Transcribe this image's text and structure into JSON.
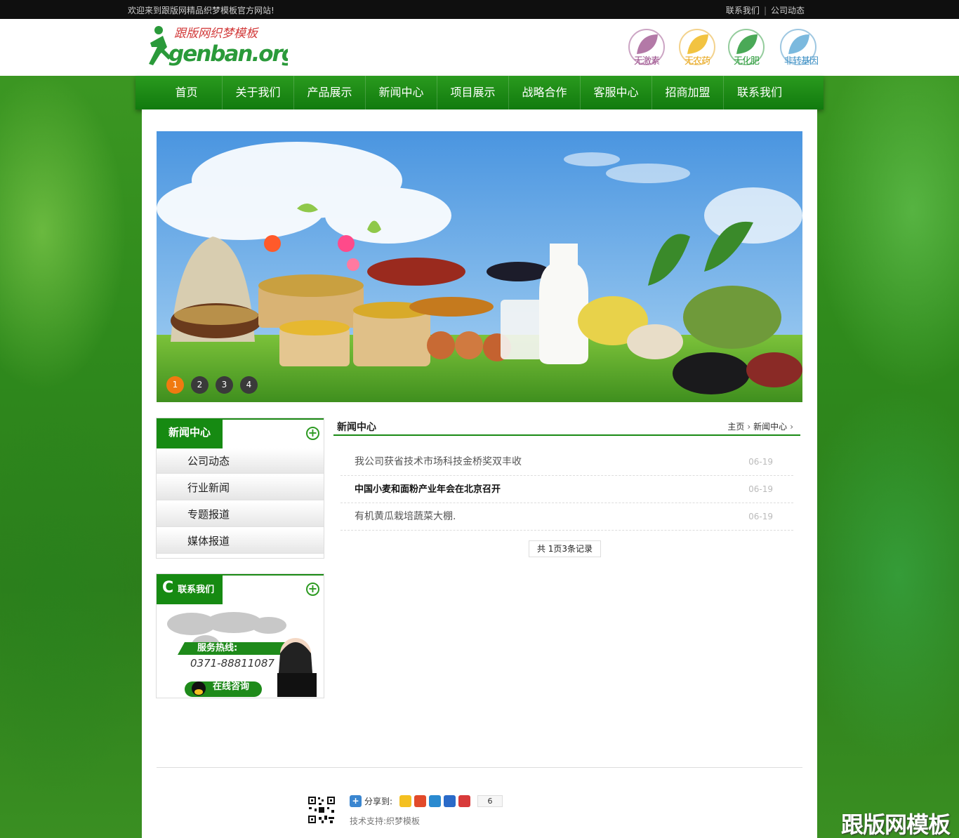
{
  "topbar": {
    "welcome": "欢迎来到跟版网精品织梦模板官方网站!",
    "links": [
      "联系我们",
      "公司动态"
    ]
  },
  "logo": {
    "cn_text": "跟版网织梦模板",
    "en_text": "genban.org"
  },
  "badges": [
    {
      "label": "无激素",
      "color": "#9a4c8a"
    },
    {
      "label": "无农药",
      "color": "#e8a61a"
    },
    {
      "label": "无化肥",
      "color": "#2a9a3a"
    },
    {
      "label": "非转基因",
      "color": "#3d8fc4"
    }
  ],
  "nav": [
    "首页",
    "关于我们",
    "产品展示",
    "新闻中心",
    "项目展示",
    "战略合作",
    "客服中心",
    "招商加盟",
    "联系我们"
  ],
  "banner": {
    "dots": [
      "1",
      "2",
      "3",
      "4"
    ],
    "active_dot": "1"
  },
  "sidebar": {
    "news": {
      "title": "新闻中心",
      "items": [
        "公司动态",
        "行业新闻",
        "专题报道",
        "媒体报道"
      ]
    },
    "contact": {
      "title": "联系我们",
      "hotline_label": "服务热线:",
      "phone": "0371-88811087",
      "consult": "在线咨询"
    }
  },
  "content": {
    "title": "新闻中心",
    "breadcrumb": [
      "主页",
      "新闻中心"
    ],
    "news": [
      {
        "title": "我公司获省技术市场科技金桥奖双丰收",
        "date": "06-19"
      },
      {
        "title": "中国小麦和面粉产业年会在北京召开",
        "date": "06-19"
      },
      {
        "title": "有机黄瓜栽培蔬菜大棚.",
        "date": "06-19"
      }
    ],
    "pager": "共 1页3条记录"
  },
  "footer": {
    "share_label": "分享到:",
    "share_count": "6",
    "tech": "技术支持:织梦模板"
  },
  "watermark": "跟版网模板",
  "colors": {
    "nav_green": "#168a12",
    "accent_orange": "#f07a10",
    "topbar": "#0f0f0f"
  }
}
